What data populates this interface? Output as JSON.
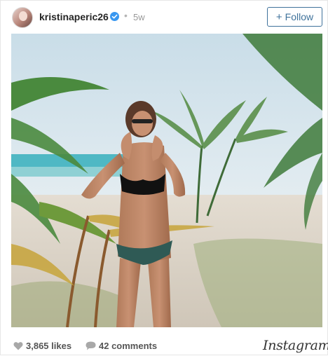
{
  "post": {
    "username": "kristinaperic26",
    "verified": true,
    "age": "5w",
    "follow_label": "Follow",
    "likes": "3,865 likes",
    "comments": "42 comments",
    "brand": "Instagram"
  },
  "icons": {
    "verified": "verified-badge-icon",
    "likes": "heart-icon",
    "comments": "speech-bubble-icon"
  },
  "colors": {
    "follow_accent": "#3f729b",
    "verified_blue": "#3897f0",
    "muted_text": "#999999"
  }
}
